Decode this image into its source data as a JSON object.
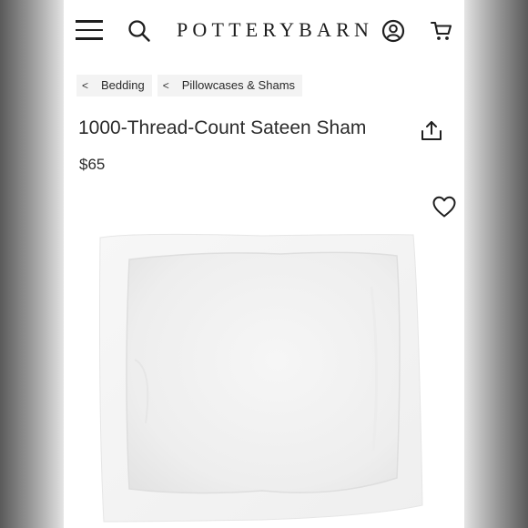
{
  "header": {
    "brand": "POTTERYBARN",
    "icons": {
      "menu": "hamburger-menu-icon",
      "search": "search-icon",
      "account": "account-icon",
      "cart": "cart-icon"
    }
  },
  "breadcrumb": [
    {
      "chevron": "<",
      "label": "Bedding"
    },
    {
      "chevron": "<",
      "label": "Pillowcases & Shams"
    }
  ],
  "product": {
    "title": "1000-Thread-Count Sateen Sham",
    "price": "$65",
    "share_icon": "share-icon",
    "favorite_icon": "heart-icon"
  },
  "colors": {
    "text": "#2b2b2b",
    "breadcrumb_bg": "#f3f3f3",
    "page_bg": "#ffffff"
  }
}
